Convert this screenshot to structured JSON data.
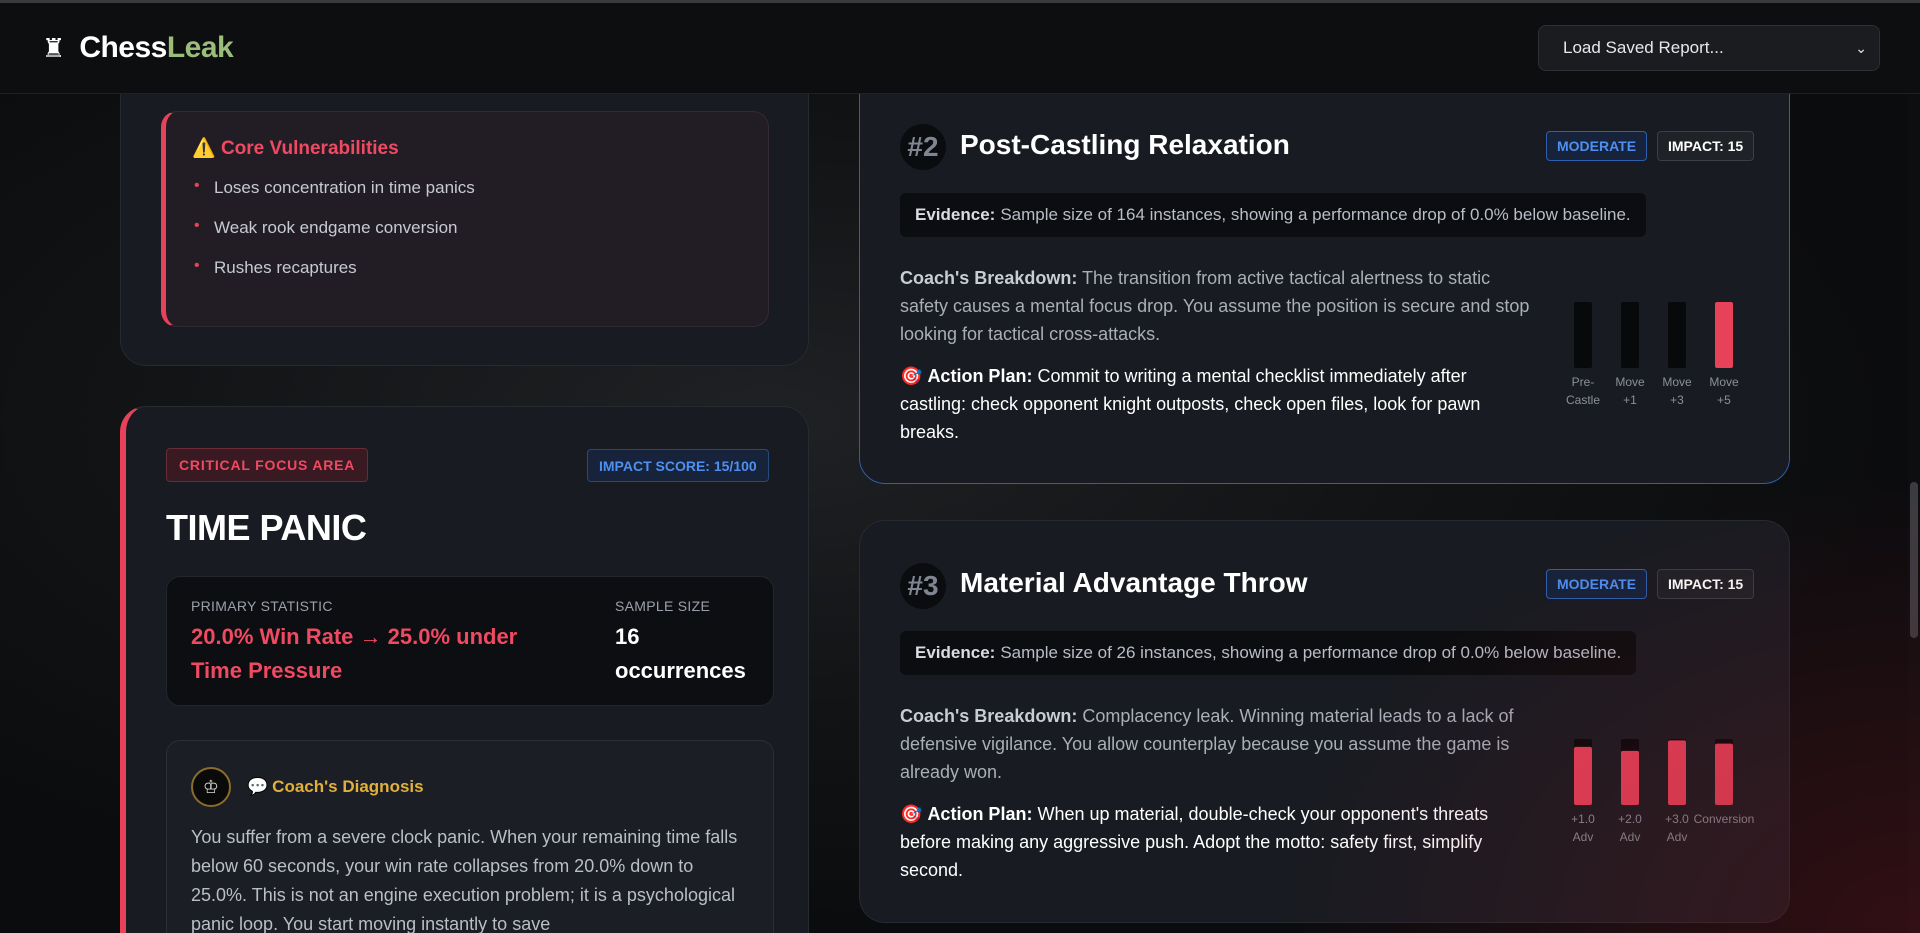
{
  "header": {
    "brand_first": "Chess",
    "brand_second": "Leak",
    "logo_icon": "chess-rook-icon",
    "report_select": "Load Saved Report...",
    "colors": {
      "brand_accent": "#9bbd7a"
    }
  },
  "vulnerabilities": {
    "title": "Core Vulnerabilities",
    "icon": "⚠️",
    "items": [
      "Loses concentration in time panics",
      "Weak rook endgame conversion",
      "Rushes recaptures"
    ]
  },
  "focus": {
    "badge": "CRITICAL FOCUS AREA",
    "impact_score": "IMPACT SCORE: 15/100",
    "title": "TIME PANIC",
    "primary_label": "PRIMARY STATISTIC",
    "primary_value": "20.0% Win Rate → 25.0% under Time Pressure",
    "sample_label": "SAMPLE SIZE",
    "sample_value": "16 occurrences",
    "diagnosis_title": "Coach's Diagnosis",
    "diagnosis_text": "You suffer from a severe clock panic. When your remaining time falls below 60 seconds, your win rate collapses from 20.0% down to 25.0%. This is not an engine execution problem; it is a psychological panic loop. You start moving instantly to save"
  },
  "patterns": [
    {
      "num": "#2",
      "title": "Post-Castling Relaxation",
      "severity": "MODERATE",
      "impact": "IMPACT: 15",
      "evidence_label": "Evidence:",
      "evidence": "Sample size of 164 instances, showing a performance drop of 0.0% below baseline.",
      "breakdown_label": "Coach's Breakdown:",
      "breakdown": "The transition from active tactical alertness to static safety causes a mental focus drop. You assume the position is secure and stop looking for tactical cross-attacks.",
      "action_label": "Action Plan:",
      "action": "Commit to writing a mental checklist immediately after castling: check opponent knight outposts, check open files, look for pawn breaks.",
      "chart_labels": [
        [
          "Pre-",
          "Castle"
        ],
        [
          "Move",
          "+1"
        ],
        [
          "Move",
          "+3"
        ],
        [
          "Move",
          "+5"
        ]
      ],
      "chart_fill": [
        0,
        0,
        0,
        1
      ]
    },
    {
      "num": "#3",
      "title": "Material Advantage Throw",
      "severity": "MODERATE",
      "impact": "IMPACT: 15",
      "evidence_label": "Evidence:",
      "evidence": "Sample size of 26 instances, showing a performance drop of 0.0% below baseline.",
      "breakdown_label": "Coach's Breakdown:",
      "breakdown": "Complacency leak. Winning material leads to a lack of defensive vigilance. You allow counterplay because you assume the game is already won.",
      "action_label": "Action Plan:",
      "action": "When up material, double-check your opponent's threats before making any aggressive push. Adopt the motto: safety first, simplify second.",
      "chart_labels": [
        [
          "+1.0",
          "Adv"
        ],
        [
          "+2.0",
          "Adv"
        ],
        [
          "+3.0",
          "Adv"
        ],
        [
          "Conversion",
          ""
        ]
      ],
      "chart_fill": [
        0.88,
        0.82,
        0.98,
        0.93
      ]
    }
  ],
  "colors": {
    "critical": "#e8415a",
    "info": "#4f8ff0",
    "gold": "#e0b03a"
  }
}
